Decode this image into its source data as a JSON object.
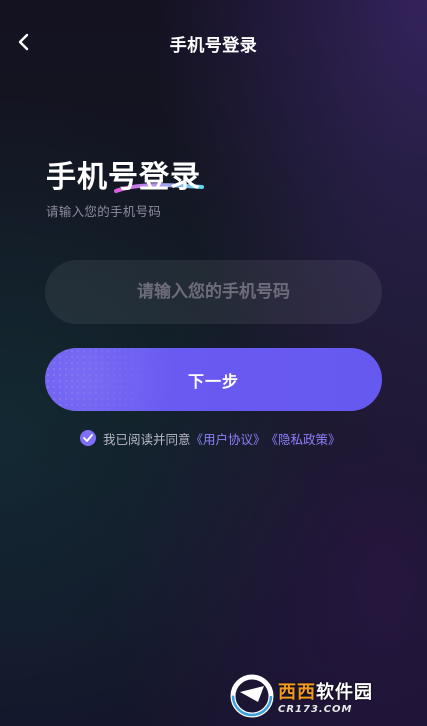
{
  "header": {
    "title": "手机号登录",
    "back_icon": "chevron-left-icon"
  },
  "main": {
    "title": "手机号登录",
    "subtitle": "请输入您的手机号码",
    "phone_input": {
      "placeholder": "请输入您的手机号码",
      "value": ""
    },
    "next_button": {
      "label": "下一步"
    },
    "agreement": {
      "checked": true,
      "text": "我已阅读并同意",
      "user_agreement": "《用户协议》",
      "privacy_policy": "《隐私政策》"
    }
  },
  "watermark": {
    "brand_orange": "西西",
    "brand_white": "软件园",
    "domain": "CR173.COM"
  },
  "colors": {
    "accent": "#6b5cf2",
    "link": "#8d7ff8",
    "subtitle": "#8d8b9d",
    "placeholder": "#6e6c7b",
    "underline_start": "#e05bd8",
    "underline_end": "#5fd6f2"
  }
}
